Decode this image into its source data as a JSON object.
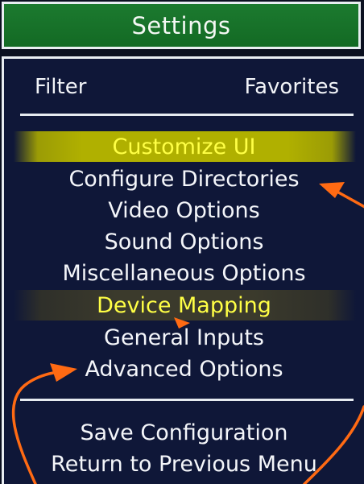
{
  "header": {
    "title": "Settings"
  },
  "filter_bar": {
    "filter_label": "Filter",
    "favorites_label": "Favorites"
  },
  "menu": {
    "items": [
      {
        "label": "Customize UI",
        "state": "selected"
      },
      {
        "label": "Configure Directories"
      },
      {
        "label": "Video Options"
      },
      {
        "label": "Sound Options"
      },
      {
        "label": "Miscellaneous Options"
      },
      {
        "label": "Device Mapping",
        "state": "hover"
      },
      {
        "label": "General Inputs"
      },
      {
        "label": "Advanced Options"
      }
    ]
  },
  "footer": {
    "save_label": "Save Configuration",
    "return_label": "Return to Previous Menu"
  },
  "colors": {
    "header_bg": "#1c7a2f",
    "panel_bg": "#0f1738",
    "selected_text": "#ffff45",
    "selected_bg": "#b0b000",
    "hover_bg": "#3b3a2c",
    "annotation": "#ff6a13"
  }
}
